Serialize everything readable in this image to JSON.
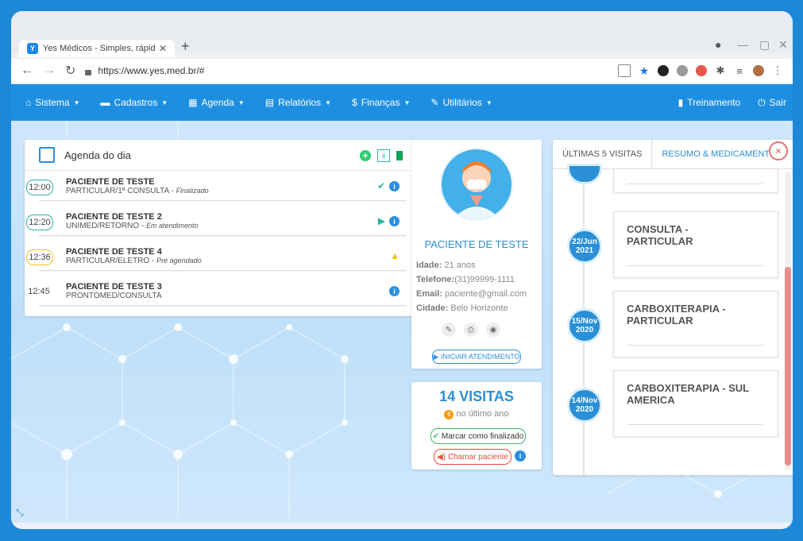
{
  "browser": {
    "tab_title": "Yes Médicos - Simples, rápido, di",
    "new_tab": "+",
    "url": "https://www.yes.med.br/#"
  },
  "appbar": {
    "menu": [
      {
        "label": "Sistema",
        "icon": "home-icon"
      },
      {
        "label": "Cadastros",
        "icon": "folder-icon"
      },
      {
        "label": "Agenda",
        "icon": "calendar-icon"
      },
      {
        "label": "Relatórios",
        "icon": "report-icon"
      },
      {
        "label": "Finanças",
        "icon": "dollar-icon"
      },
      {
        "label": "Utilitários",
        "icon": "wrench-icon"
      }
    ],
    "training": "Treinamento",
    "logout": "Sair"
  },
  "agenda": {
    "title": "Agenda do dia",
    "rows": [
      {
        "time": "12:00",
        "name": "PACIENTE DE TESTE",
        "desc": "PARTICULAR/1ª CONSULTA",
        "status": "Finalizado",
        "color": "#2bb5a0"
      },
      {
        "time": "12:20",
        "name": "PACIENTE DE TESTE 2",
        "desc": "UNIMED/RETORNO",
        "status": "Em atendimento",
        "color": "#2bb5a0"
      },
      {
        "time": "12:36",
        "name": "PACIENTE DE TESTE 4",
        "desc": "PARTICULAR/ELETRO",
        "status": "Pré agendado",
        "color": "#f1c40f"
      },
      {
        "time": "12:45",
        "name": "PACIENTE DE TESTE 3",
        "desc": "PRONTOMED/CONSULTA",
        "status": "",
        "color": "#ffffff"
      }
    ],
    "add_icon": "plus-icon",
    "badge_count": "4"
  },
  "patient": {
    "name": "PACIENTE DE TESTE",
    "age_label": "Idade:",
    "age": "21 anos",
    "phone_label": "Telefone:",
    "phone": "(31)99999-1111",
    "email_label": "Email:",
    "email": "paciente@gmail.com",
    "city_label": "Cidade:",
    "city": "Belo Horizonte",
    "start_button": "INICIAR ATENDIMENTO"
  },
  "visits": {
    "count_title": "14 VISITAS",
    "last_year_count": "6",
    "last_year_label": "no último ano",
    "finish_button": "Marcar como finalizado",
    "call_button": "Chamar paciente"
  },
  "history": {
    "tab_last": "ÚLTIMAS 5 VISITAS",
    "tab_summary": "RESUMO & MEDICAMENTOS",
    "close": "×",
    "events": [
      {
        "date": "22/Jun 2021",
        "title_line1": "CONSULTA -",
        "title_line2": "PARTICULAR"
      },
      {
        "date": "15/Nov 2020",
        "title_line1": "CARBOXITERAPIA -",
        "title_line2": "PARTICULAR"
      },
      {
        "date": "14/Nov 2020",
        "title_line1": "CARBOXITERAPIA - SUL",
        "title_line2": "AMERICA"
      }
    ]
  }
}
